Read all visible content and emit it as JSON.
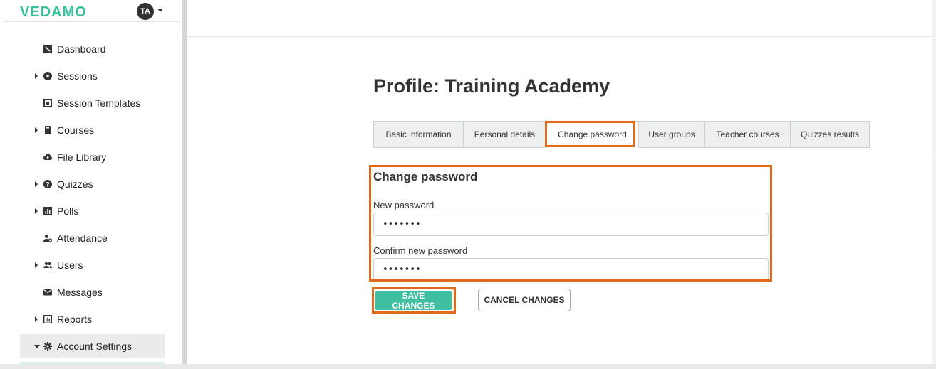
{
  "brand": {
    "logo": "VEDAMO",
    "avatar_initials": "TA"
  },
  "sidebar": {
    "items": [
      {
        "label": "Dashboard",
        "icon": "dashboard-icon",
        "expandable": false
      },
      {
        "label": "Sessions",
        "icon": "play-circle-icon",
        "expandable": true
      },
      {
        "label": "Session Templates",
        "icon": "template-icon",
        "expandable": false
      },
      {
        "label": "Courses",
        "icon": "book-icon",
        "expandable": true
      },
      {
        "label": "File Library",
        "icon": "cloud-upload-icon",
        "expandable": false
      },
      {
        "label": "Quizzes",
        "icon": "question-circle-icon",
        "expandable": true
      },
      {
        "label": "Polls",
        "icon": "bar-chart-icon",
        "expandable": true
      },
      {
        "label": "Attendance",
        "icon": "user-check-icon",
        "expandable": false
      },
      {
        "label": "Users",
        "icon": "users-icon",
        "expandable": true
      },
      {
        "label": "Messages",
        "icon": "envelope-icon",
        "expandable": false
      },
      {
        "label": "Reports",
        "icon": "report-icon",
        "expandable": true
      },
      {
        "label": "Account Settings",
        "icon": "gear-icon",
        "expandable": true,
        "active": true
      }
    ]
  },
  "main": {
    "title": "Profile: Training Academy",
    "tabs": [
      {
        "label": "Basic information"
      },
      {
        "label": "Personal details"
      },
      {
        "label": "Change password",
        "active": true
      },
      {
        "label": "User groups"
      },
      {
        "label": "Teacher courses"
      },
      {
        "label": "Quizzes results"
      }
    ],
    "form": {
      "section_title": "Change password",
      "new_password": {
        "label": "New password",
        "value": "•••••••"
      },
      "confirm_password": {
        "label": "Confirm new password",
        "value": "•••••••"
      },
      "save_label": "SAVE CHANGES",
      "cancel_label": "CANCEL CHANGES"
    }
  },
  "colors": {
    "accent": "#3fbfa0",
    "highlight": "#e06b1a"
  }
}
